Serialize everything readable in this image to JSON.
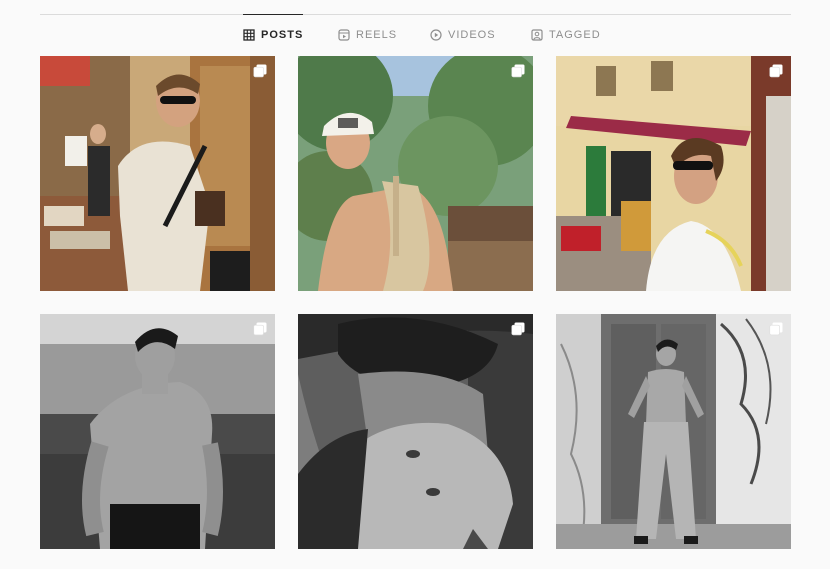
{
  "tabs": [
    {
      "label": "POSTS",
      "icon": "grid-icon",
      "active": true
    },
    {
      "label": "REELS",
      "icon": "reels-icon",
      "active": false
    },
    {
      "label": "VIDEOS",
      "icon": "play-circle-icon",
      "active": false
    },
    {
      "label": "TAGGED",
      "icon": "tagged-user-icon",
      "active": false
    }
  ],
  "posts": [
    {
      "type": "carousel",
      "icon": "multiple-photos-icon"
    },
    {
      "type": "carousel",
      "icon": "multiple-photos-icon"
    },
    {
      "type": "carousel",
      "icon": "multiple-photos-icon"
    },
    {
      "type": "carousel",
      "icon": "multiple-photos-icon"
    },
    {
      "type": "carousel",
      "icon": "multiple-photos-icon"
    },
    {
      "type": "carousel",
      "icon": "multiple-photos-icon"
    }
  ],
  "colors": {
    "active_tab": "#262626",
    "inactive_tab": "#8e8e8e",
    "divider": "#dbdbdb"
  }
}
